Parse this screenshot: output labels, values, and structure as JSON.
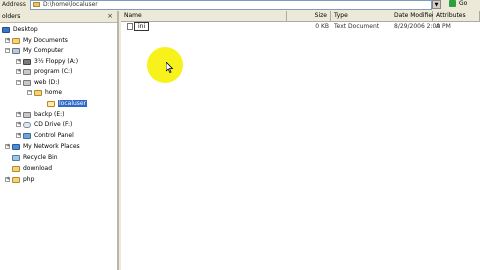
{
  "address_bar": {
    "label": "Address",
    "path": "D:\\home\\localuser",
    "go_label": "Go"
  },
  "folders_pane": {
    "title": "olders",
    "close_glyph": "×"
  },
  "tree": [
    {
      "label": "Desktop"
    },
    {
      "label": "My Documents"
    },
    {
      "label": "My Computer"
    },
    {
      "label": "3½ Floppy (A:)"
    },
    {
      "label": "program (C:)"
    },
    {
      "label": "web (D:)"
    },
    {
      "label": "home"
    },
    {
      "label": "localuser"
    },
    {
      "label": "backp (E:)"
    },
    {
      "label": "CD Drive (F:)"
    },
    {
      "label": "Control Panel"
    },
    {
      "label": "My Network Places"
    },
    {
      "label": "Recycle Bin"
    },
    {
      "label": "download"
    },
    {
      "label": "php"
    }
  ],
  "file_list": {
    "columns": [
      "Name",
      "Size",
      "Type",
      "Date Modified",
      "Attributes"
    ],
    "rows": [
      {
        "name": "ini",
        "size": "0 KB",
        "type": "Text Document",
        "date": "8/29/2006 2:00 PM",
        "attributes": "A"
      }
    ]
  },
  "colors": {
    "selection": "#316ac5",
    "cursor_highlight": "#f7f21c"
  }
}
